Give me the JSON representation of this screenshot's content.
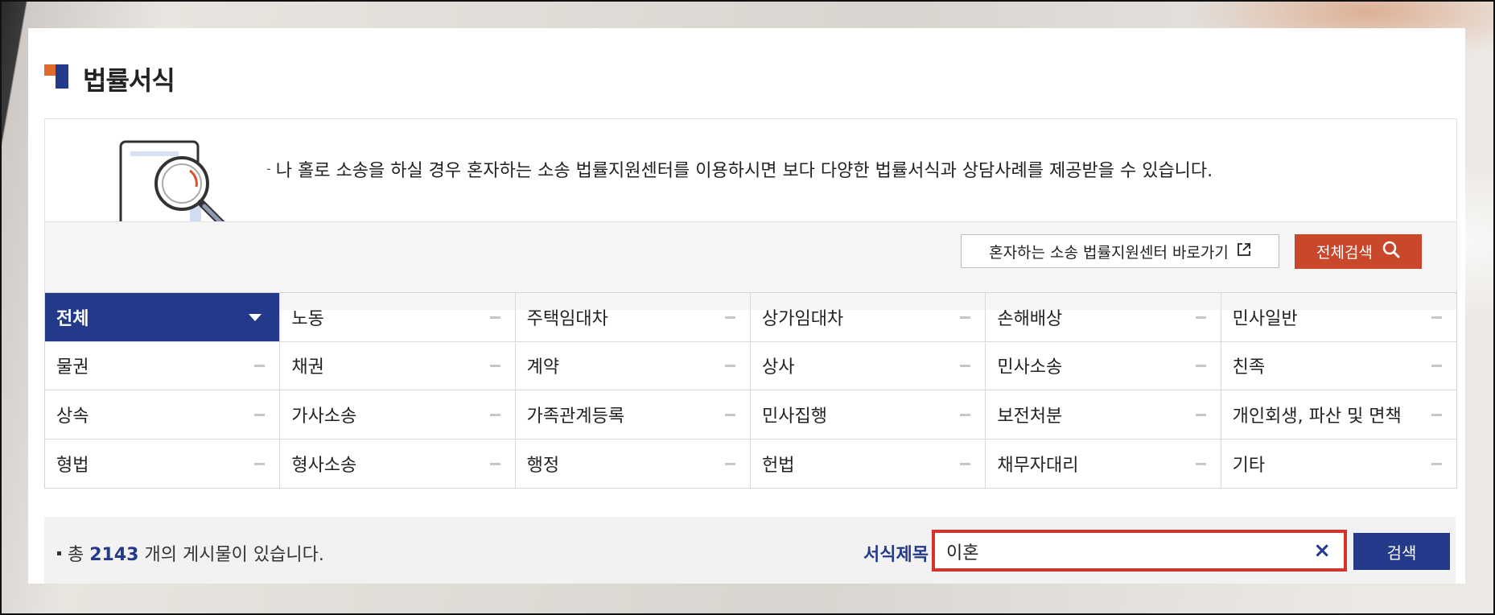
{
  "page": {
    "title": "법률서식"
  },
  "intro": {
    "text": "나 홀로 소송을 하실 경우 혼자하는 소송 법률지원센터를 이용하시면 보다 다양한 법률서식과 상담사례를 제공받을 수 있습니다.",
    "link_label": "혼자하는 소송 법률지원센터 바로가기",
    "search_all_label": "전체검색"
  },
  "categories": [
    {
      "label": "전체",
      "active": true
    },
    {
      "label": "노동"
    },
    {
      "label": "주택임대차"
    },
    {
      "label": "상가임대차"
    },
    {
      "label": "손해배상"
    },
    {
      "label": "민사일반"
    },
    {
      "label": "물권"
    },
    {
      "label": "채권"
    },
    {
      "label": "계약"
    },
    {
      "label": "상사"
    },
    {
      "label": "민사소송"
    },
    {
      "label": "친족"
    },
    {
      "label": "상속"
    },
    {
      "label": "가사소송"
    },
    {
      "label": "가족관계등록"
    },
    {
      "label": "민사집행"
    },
    {
      "label": "보전처분"
    },
    {
      "label": "개인회생, 파산 및 면책"
    },
    {
      "label": "형법"
    },
    {
      "label": "형사소송"
    },
    {
      "label": "행정"
    },
    {
      "label": "헌법"
    },
    {
      "label": "채무자대리"
    },
    {
      "label": "기타"
    }
  ],
  "search": {
    "count_prefix": "총",
    "count": "2143",
    "count_suffix": "개의 게시물이 있습니다.",
    "field_label": "서식제목",
    "input_value": "이혼",
    "clear_symbol": "×",
    "submit_label": "검색"
  },
  "colors": {
    "primary": "#233a8a",
    "accent": "#c9472a",
    "highlight_border": "#d0362d"
  }
}
